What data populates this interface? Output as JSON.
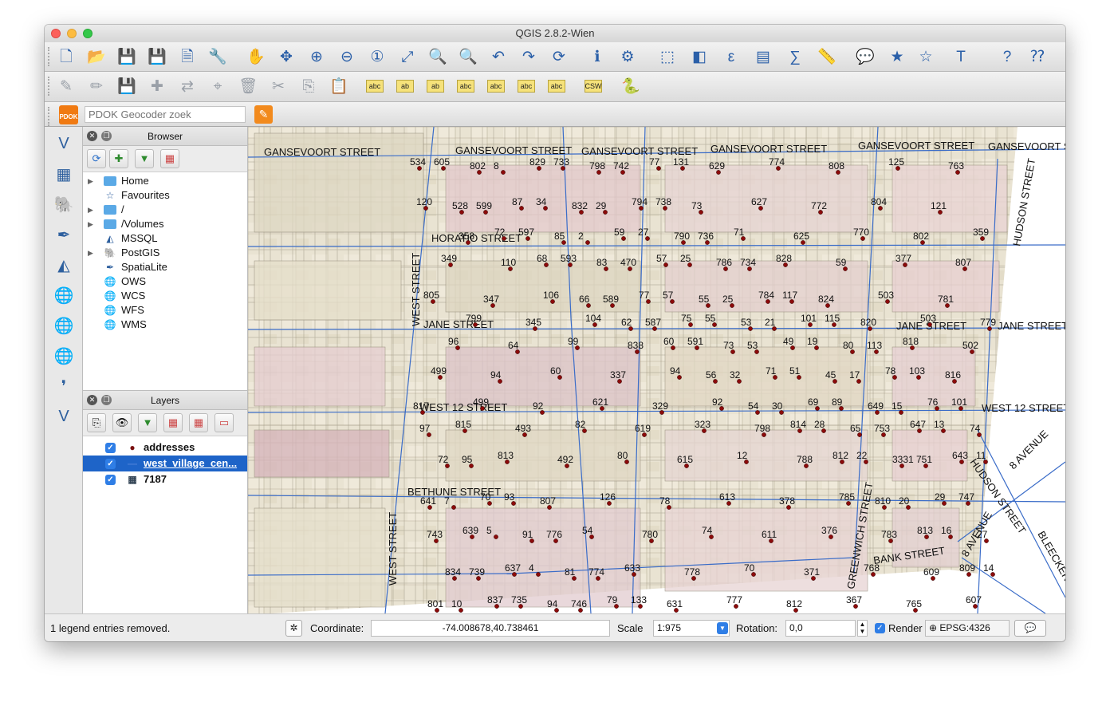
{
  "window": {
    "title": "QGIS 2.8.2-Wien"
  },
  "toolbars": {
    "main": [
      {
        "name": "new-project-icon",
        "glyph": "🗋"
      },
      {
        "name": "open-project-icon",
        "glyph": "📂"
      },
      {
        "name": "save-project-icon",
        "glyph": "💾"
      },
      {
        "name": "save-as-icon",
        "glyph": "💾"
      },
      {
        "name": "new-print-composer-icon",
        "glyph": "🗎"
      },
      {
        "name": "composer-manager-icon",
        "glyph": "🔧"
      },
      {
        "name": "pan-map-icon",
        "glyph": "✋"
      },
      {
        "name": "pan-to-selection-icon",
        "glyph": "✥"
      },
      {
        "name": "zoom-in-icon",
        "glyph": "⊕"
      },
      {
        "name": "zoom-out-icon",
        "glyph": "⊖"
      },
      {
        "name": "zoom-native-icon",
        "glyph": "①"
      },
      {
        "name": "zoom-full-icon",
        "glyph": "⤢"
      },
      {
        "name": "zoom-to-selection-icon",
        "glyph": "🔍"
      },
      {
        "name": "zoom-to-layer-icon",
        "glyph": "🔍"
      },
      {
        "name": "zoom-last-icon",
        "glyph": "↶"
      },
      {
        "name": "zoom-next-icon",
        "glyph": "↷"
      },
      {
        "name": "refresh-icon",
        "glyph": "⟳"
      },
      {
        "name": "identify-icon",
        "glyph": "ℹ"
      },
      {
        "name": "run-feature-action-icon",
        "glyph": "⚙"
      },
      {
        "name": "select-features-icon",
        "glyph": "⬚"
      },
      {
        "name": "deselect-features-icon",
        "glyph": "◧"
      },
      {
        "name": "select-by-expression-icon",
        "glyph": "ε"
      },
      {
        "name": "open-attribute-table-icon",
        "glyph": "▤"
      },
      {
        "name": "statistical-summary-icon",
        "glyph": "∑"
      },
      {
        "name": "measure-line-icon",
        "glyph": "📏"
      },
      {
        "name": "map-tips-icon",
        "glyph": "💬"
      },
      {
        "name": "new-bookmark-icon",
        "glyph": "★"
      },
      {
        "name": "show-bookmarks-icon",
        "glyph": "☆"
      },
      {
        "name": "text-annotation-icon",
        "glyph": "T"
      },
      {
        "name": "help-contents-icon",
        "glyph": "?"
      },
      {
        "name": "whats-this-icon",
        "glyph": "⁇"
      }
    ],
    "digitizing": [
      {
        "name": "current-edits-icon",
        "glyph": "✎"
      },
      {
        "name": "toggle-editing-icon",
        "glyph": "✏"
      },
      {
        "name": "save-layer-edits-icon",
        "glyph": "💾"
      },
      {
        "name": "add-feature-icon",
        "glyph": "✚"
      },
      {
        "name": "move-feature-icon",
        "glyph": "⇄"
      },
      {
        "name": "node-tool-icon",
        "glyph": "⌖"
      },
      {
        "name": "delete-selected-icon",
        "glyph": "🗑"
      },
      {
        "name": "cut-features-icon",
        "glyph": "✂"
      },
      {
        "name": "copy-features-icon",
        "glyph": "⎘"
      },
      {
        "name": "paste-features-icon",
        "glyph": "📋"
      },
      {
        "name": "label-layer-icon",
        "glyph": "abc"
      },
      {
        "name": "label-pin-icon",
        "glyph": "ab"
      },
      {
        "name": "label-highlight-icon",
        "glyph": "ab"
      },
      {
        "name": "label-show-hide-icon",
        "glyph": "abc"
      },
      {
        "name": "label-move-icon",
        "glyph": "abc"
      },
      {
        "name": "label-rotate-icon",
        "glyph": "abc"
      },
      {
        "name": "label-change-icon",
        "glyph": "abc"
      },
      {
        "name": "csw-icon",
        "glyph": "CSW"
      },
      {
        "name": "python-console-icon",
        "glyph": "🐍"
      }
    ]
  },
  "pdok": {
    "placeholder": "PDOK Geocoder zoek",
    "icon_text": "PDOK"
  },
  "left_tools": [
    "add-vector-layer-icon",
    "add-raster-layer-icon",
    "add-postgis-layer-icon",
    "add-spatialite-layer-icon",
    "add-mssql-layer-icon",
    "add-wms-layer-icon",
    "add-wcs-layer-icon",
    "add-wfs-layer-icon",
    "add-delimited-text-icon",
    "new-shapefile-icon"
  ],
  "browser": {
    "title": "Browser",
    "items": [
      {
        "label": "Home",
        "icon": "folder-icon",
        "expandable": true
      },
      {
        "label": "Favourites",
        "icon": "star-icon",
        "expandable": false
      },
      {
        "label": "/",
        "icon": "folder-icon",
        "expandable": true
      },
      {
        "label": "/Volumes",
        "icon": "folder-icon",
        "expandable": true
      },
      {
        "label": "MSSQL",
        "icon": "mssql-icon",
        "expandable": false
      },
      {
        "label": "PostGIS",
        "icon": "postgis-icon",
        "expandable": true
      },
      {
        "label": "SpatiaLite",
        "icon": "spatialite-icon",
        "expandable": false
      },
      {
        "label": "OWS",
        "icon": "ows-globe-icon",
        "expandable": false
      },
      {
        "label": "WCS",
        "icon": "wcs-globe-icon",
        "expandable": false
      },
      {
        "label": "WFS",
        "icon": "wfs-globe-icon",
        "expandable": false
      },
      {
        "label": "WMS",
        "icon": "wms-globe-icon",
        "expandable": false
      }
    ]
  },
  "layers": {
    "title": "Layers",
    "items": [
      {
        "label": "addresses",
        "selected": false,
        "checked": true,
        "symbol": "point"
      },
      {
        "label": "west_village_cen...",
        "selected": true,
        "checked": true,
        "symbol": "line"
      },
      {
        "label": "7187",
        "selected": false,
        "checked": true,
        "symbol": "raster"
      }
    ]
  },
  "map": {
    "street_labels": [
      "GANSEVOORT STREET",
      "GANSEVOORT STREET",
      "GANSEVOORT STREET",
      "GANSEVOORT STREET",
      "GANSEVOORT STREET",
      "GANSEVOORT S",
      "HORATIO STREET",
      "JANE STREET",
      "JANE STREET",
      "JANE STREET",
      "WEST 12 STREET",
      "WEST 12 STREET",
      "BETHUNE STREET",
      "BANK STREET",
      "WEST STREET",
      "WEST STREET",
      "HUDSON STREET",
      "HUDSON STREET",
      "GREENWICH STREET",
      "8 AVENUE",
      "8 AVENUE",
      "BLEECKER STRE"
    ],
    "address_labels": [
      "534",
      "528",
      "72",
      "68",
      "66",
      "62",
      "60",
      "56",
      "54",
      "814",
      "812",
      "810",
      "813",
      "809",
      "801",
      "802",
      "87",
      "85",
      "83",
      "77",
      "75",
      "73",
      "71",
      "69",
      "65",
      "3331",
      "29",
      "27",
      "834",
      "837",
      "829",
      "832",
      "59",
      "57",
      "55",
      "53",
      "49",
      "45",
      "649",
      "647",
      "643",
      "641",
      "639",
      "637",
      "94",
      "798",
      "794",
      "790",
      "786",
      "784",
      "101",
      "80",
      "78",
      "76",
      "74",
      "72",
      "70",
      "91",
      "81",
      "79",
      "77",
      "73",
      "71",
      "828",
      "824",
      "820",
      "818",
      "816",
      "817",
      "815",
      "813",
      "807",
      "54",
      "633",
      "631",
      "629",
      "627",
      "625",
      "59",
      "503",
      "503",
      "502",
      "499",
      "499",
      "493",
      "492",
      "126",
      "780",
      "778",
      "777",
      "774",
      "772",
      "770",
      "377",
      "781",
      "779",
      "96",
      "94",
      "92",
      "82",
      "80",
      "78",
      "74",
      "70",
      "812",
      "808",
      "804",
      "802",
      "807",
      "805",
      "799",
      "64",
      "60",
      "621",
      "619",
      "615",
      "613",
      "611",
      "371",
      "367",
      "125",
      "121",
      "359",
      "349",
      "347",
      "345",
      "99",
      "337",
      "329",
      "323",
      "12",
      "378",
      "376",
      "768",
      "765",
      "763",
      "120",
      "358",
      "110",
      "106",
      "104",
      "838",
      "94",
      "92",
      "798",
      "788",
      "785",
      "783",
      "609",
      "607",
      "605",
      "599",
      "597",
      "593",
      "589",
      "587",
      "591",
      "32",
      "30",
      "28",
      "22",
      "20",
      "16",
      "14",
      "10",
      "8",
      "34",
      "2",
      "470",
      "57",
      "55",
      "53",
      "51",
      "89",
      "753",
      "751",
      "747",
      "743",
      "739",
      "735",
      "733",
      "29",
      "27",
      "25",
      "25",
      "21",
      "19",
      "17",
      "15",
      "13",
      "11",
      "7",
      "5",
      "4",
      "746",
      "742",
      "738",
      "736",
      "734",
      "117",
      "115",
      "113",
      "103",
      "101",
      "97",
      "95",
      "93",
      "776",
      "774",
      "133",
      "131"
    ]
  },
  "status": {
    "message": "1 legend entries removed.",
    "coordinate_label": "Coordinate:",
    "coordinate_value": "-74.008678,40.738461",
    "scale_label": "Scale",
    "scale_value": "1:975",
    "rotation_label": "Rotation:",
    "rotation_value": "0,0",
    "render_label": "Render",
    "crs": "EPSG:4326"
  }
}
